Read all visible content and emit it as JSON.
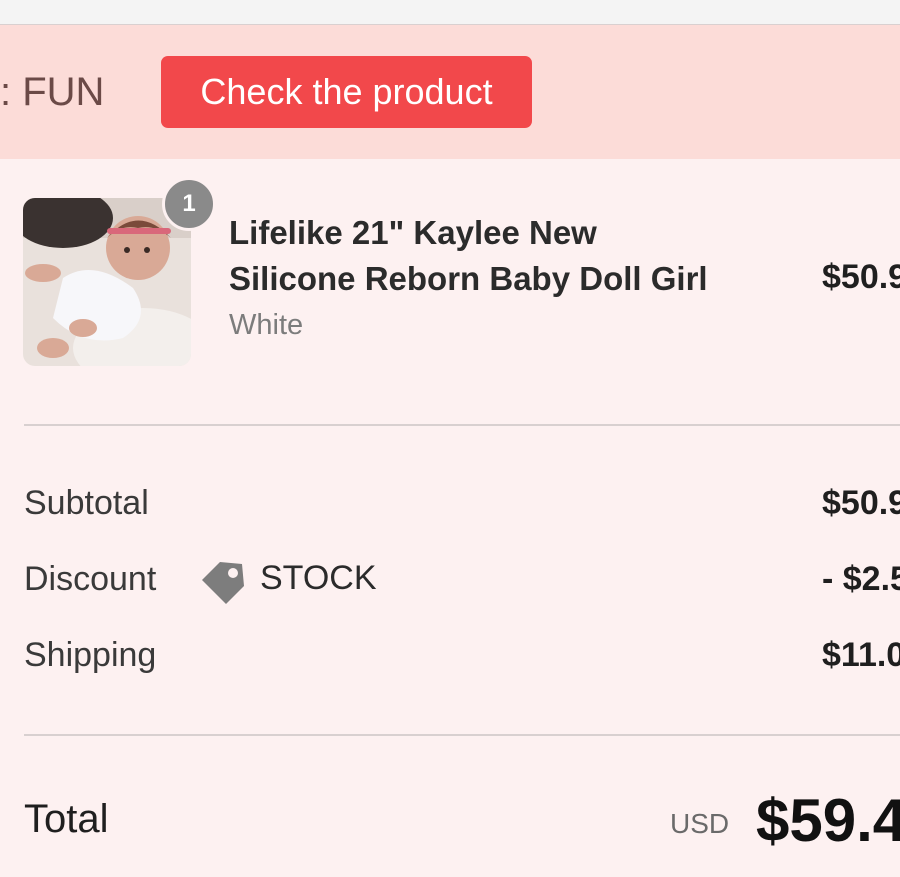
{
  "banner": {
    "promo_text": ": FUN",
    "cta_label": "Check the product"
  },
  "item": {
    "quantity": "1",
    "title_line1": "Lifelike 21\" Kaylee New",
    "title_line2": "Silicone Reborn Baby Doll Girl",
    "variant": "White",
    "price": "$50.9"
  },
  "summary": {
    "subtotal_label": "Subtotal",
    "subtotal_value": "$50.9",
    "discount_label": "Discount",
    "discount_code": "STOCK",
    "discount_icon": "tag-icon",
    "discount_value": "- $2.5",
    "shipping_label": "Shipping",
    "shipping_value": "$11.0"
  },
  "total": {
    "label": "Total",
    "currency": "USD",
    "amount": "$59.4"
  },
  "colors": {
    "banner_bg": "#fcdcd8",
    "cta_bg": "#f2484b",
    "page_bg": "#fdf1f1"
  }
}
